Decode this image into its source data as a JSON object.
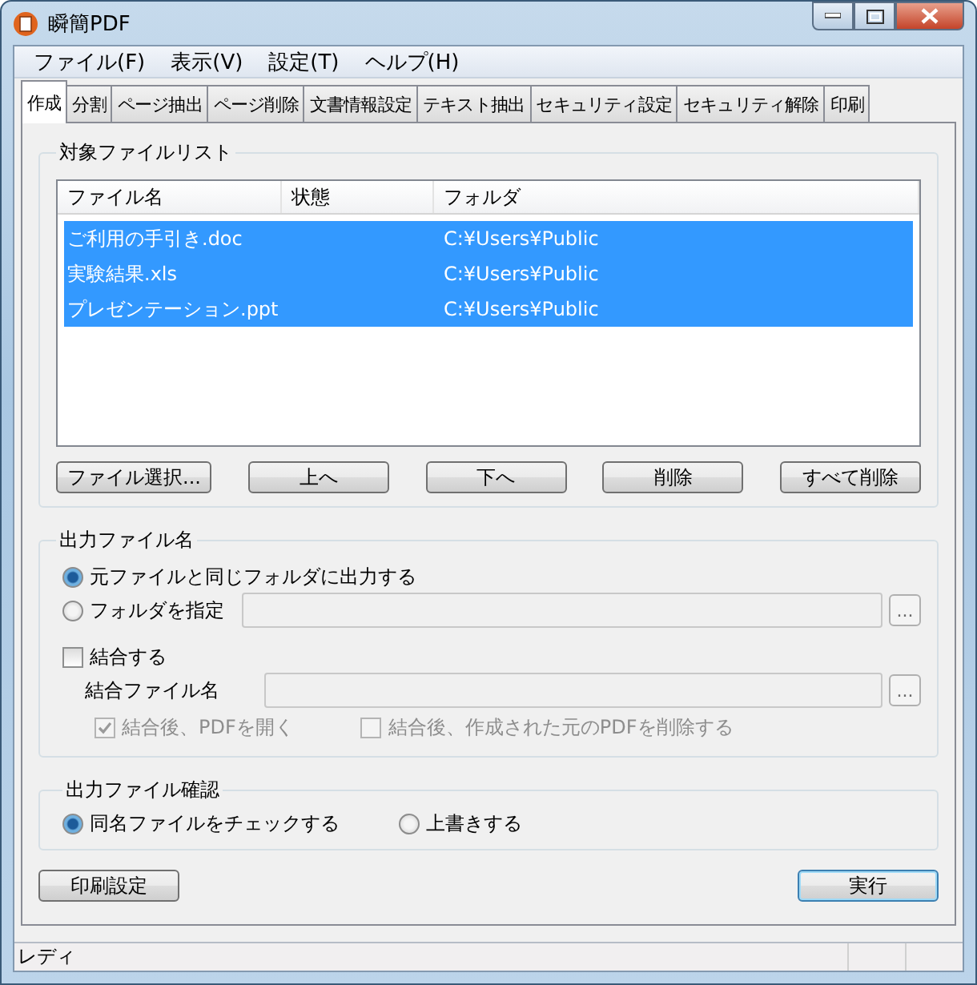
{
  "window": {
    "title": "瞬簡PDF"
  },
  "menu": [
    "ファイル(F)",
    "表示(V)",
    "設定(T)",
    "ヘルプ(H)"
  ],
  "tabs": [
    {
      "label": "作成",
      "selected": true
    },
    {
      "label": "分割",
      "selected": false
    },
    {
      "label": "ページ抽出",
      "selected": false
    },
    {
      "label": "ページ削除",
      "selected": false
    },
    {
      "label": "文書情報設定",
      "selected": false
    },
    {
      "label": "テキスト抽出",
      "selected": false
    },
    {
      "label": "セキュリティ設定",
      "selected": false
    },
    {
      "label": "セキュリティ解除",
      "selected": false
    },
    {
      "label": "印刷",
      "selected": false
    }
  ],
  "file_list": {
    "title": "対象ファイルリスト",
    "columns": [
      "ファイル名",
      "状態",
      "フォルダ"
    ],
    "rows": [
      {
        "name": "ご利用の手引き.doc",
        "folder": "C:¥Users¥Public",
        "selected": true
      },
      {
        "name": "実験結果.xls",
        "folder": "C:¥Users¥Public",
        "selected": true
      },
      {
        "name": "プレゼンテーション.ppt",
        "folder": "C:¥Users¥Public",
        "selected": true
      }
    ],
    "buttons": [
      "ファイル選択...",
      "上へ",
      "下へ",
      "削除",
      "すべて削除"
    ]
  },
  "output_name": {
    "title": "出力ファイル名",
    "same_folder": {
      "label": "元ファイルと同じフォルダに出力する",
      "selected": true
    },
    "specify_folder": {
      "label": "フォルダを指定",
      "selected": false,
      "field_disabled": true,
      "browse": "..."
    },
    "combine": {
      "label": "結合する",
      "checked": false
    },
    "combine_file": {
      "label": "結合ファイル名",
      "field_disabled": true,
      "browse": "..."
    },
    "after_options": [
      {
        "label": "結合後、PDFを開く",
        "checked": true,
        "disabled": true
      },
      {
        "label": "結合後、作成された元のPDFを削除する",
        "checked": false,
        "disabled": true
      }
    ]
  },
  "output_check": {
    "title": "出力ファイル確認",
    "options": [
      {
        "label": "同名ファイルをチェックする",
        "selected": true
      },
      {
        "label": "上書きする",
        "selected": false
      }
    ]
  },
  "print_settings": "印刷設定",
  "execute": "実行",
  "status_bar": "レディ"
}
